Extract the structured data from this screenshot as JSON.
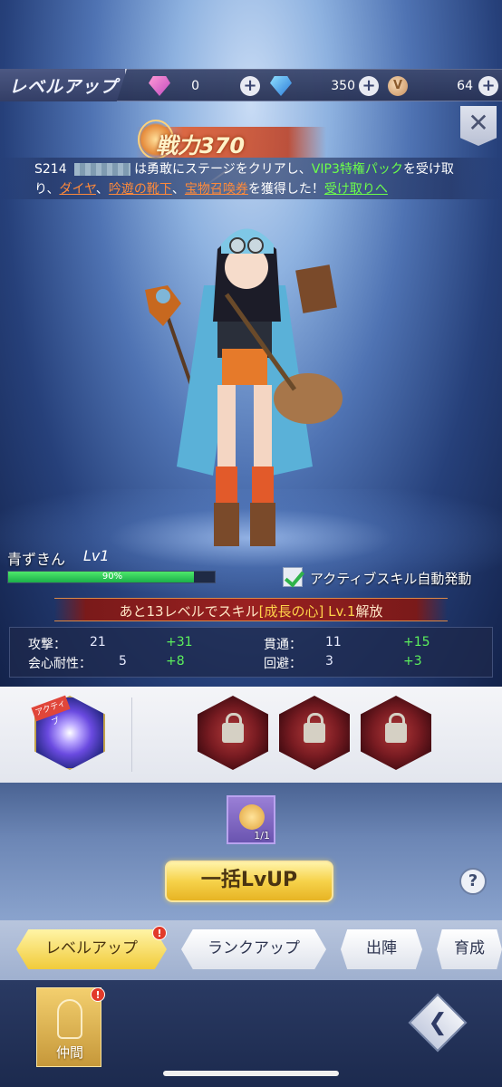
{
  "header": {
    "title": "レベルアップ",
    "currencies": [
      {
        "icon": "pink-gem-icon",
        "value": "0"
      },
      {
        "icon": "blue-gem-icon",
        "value": "350"
      },
      {
        "icon": "v-coin-icon",
        "value": "64",
        "glyph": "V"
      }
    ],
    "plus": "+",
    "close": "✕"
  },
  "power": {
    "label": "戦力370"
  },
  "notice": {
    "server": "S214",
    "text1": "は勇敢にステージをクリアし、",
    "vip": "VIP3特権パック",
    "text2": "を受け取",
    "text3": "り、",
    "item1": "ダイヤ",
    "sep1": "、",
    "item2": "吟遊の靴下",
    "sep2": "、",
    "item3": "宝物召喚券",
    "text4": "を獲得した！",
    "claim": "受け取りへ"
  },
  "character": {
    "name": "青ずきん",
    "level": "Lv1",
    "xp_percent": 90,
    "xp_label": "90%",
    "auto_skill_label": "アクティブスキル自動発動",
    "auto_skill_checked": true
  },
  "unlock": {
    "prefix": "あと13レベルでスキル",
    "skill": "[成長の心] Lv.1",
    "suffix": "解放"
  },
  "stats": [
    {
      "label": "攻撃：",
      "value": "21",
      "bonus": "+31"
    },
    {
      "label": "貫通：",
      "value": "11",
      "bonus": "+15"
    },
    {
      "label": "会心耐性：",
      "value": "5",
      "bonus": "+8"
    },
    {
      "label": "回避：",
      "value": "3",
      "bonus": "+3"
    }
  ],
  "skills": {
    "active_tag": "アクティブ"
  },
  "item": {
    "count": "1/1"
  },
  "actions": {
    "bulk_levelup": "一括LvUP",
    "help": "?"
  },
  "tabs": [
    {
      "label": "レベルアップ",
      "active": true,
      "badge": "!"
    },
    {
      "label": "ランクアップ"
    },
    {
      "label": "出陣"
    },
    {
      "label": "育成"
    }
  ],
  "bottom_nav": {
    "companion_label": "仲間",
    "companion_badge": "!",
    "back": "❮"
  },
  "colors": {
    "accent_gold": "#f1cb3a",
    "bonus_green": "#5cf05c",
    "highlight_orange": "#ff8a3a",
    "highlight_green": "#6cff4a"
  }
}
